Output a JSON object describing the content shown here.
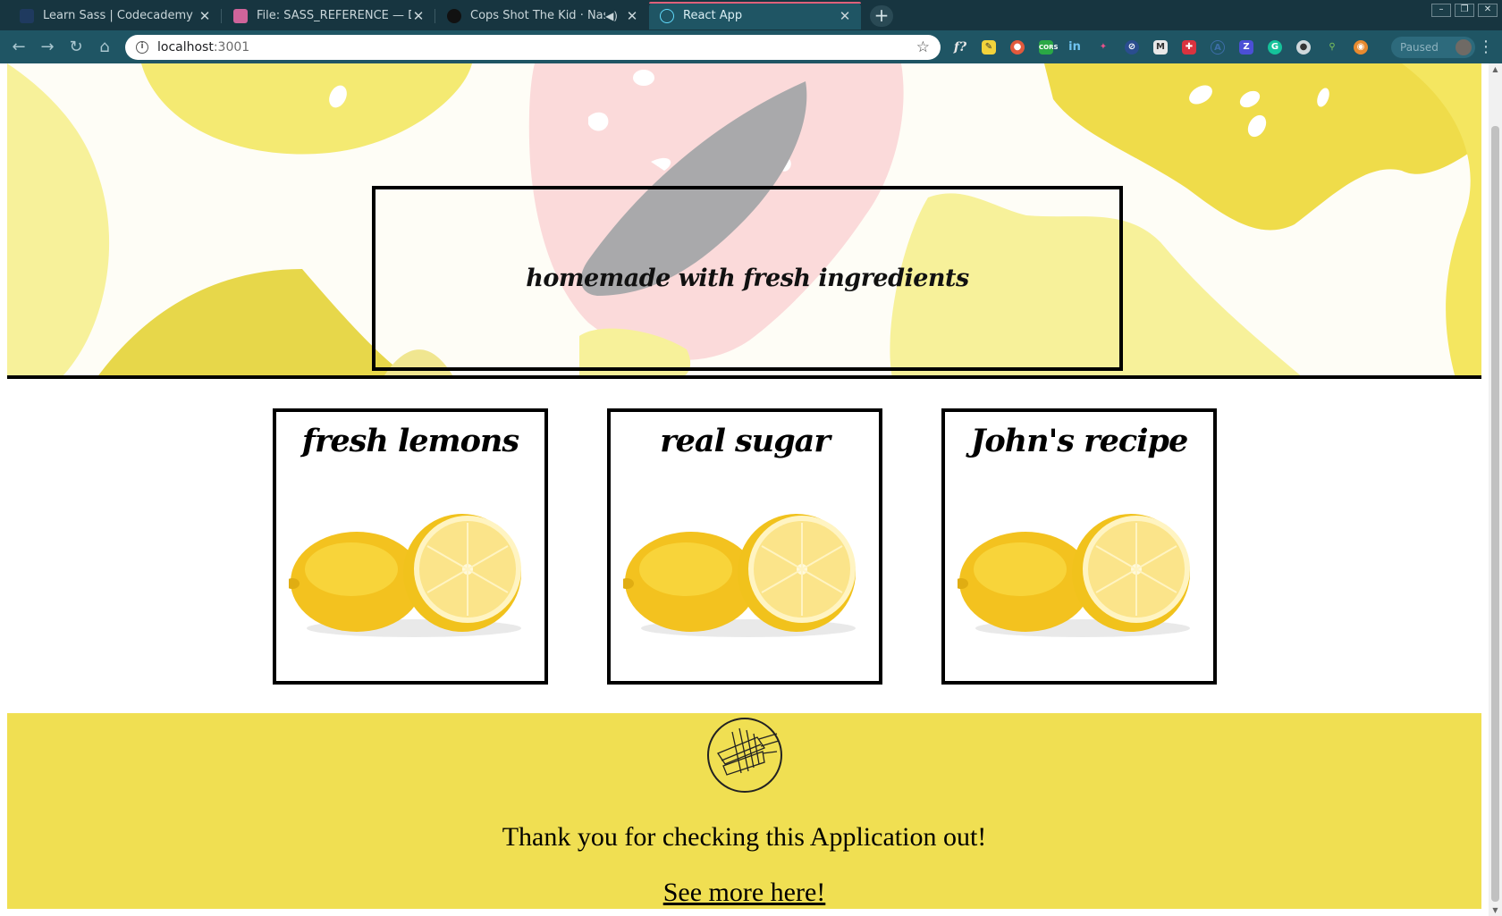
{
  "browser": {
    "tabs": [
      {
        "title": "Learn Sass | Codecademy",
        "favicon": "codecademy-icon",
        "color": "#1f3a5f"
      },
      {
        "title": "File: SASS_REFERENCE — Docu",
        "favicon": "sass-icon",
        "color": "#cf649a"
      },
      {
        "title": "Cops Shot The Kid · Nas, Ka",
        "favicon": "spotify-icon",
        "color": "#111111"
      },
      {
        "title": "React App",
        "favicon": "react-icon",
        "color": "#61dafb"
      }
    ],
    "address": {
      "host": "localhost",
      "port": ":3001"
    },
    "profile_status": "Paused"
  },
  "page": {
    "tagline": "homemade with fresh ingredients",
    "cards": [
      {
        "title": "fresh lemons"
      },
      {
        "title": "real sugar"
      },
      {
        "title": "John's recipe"
      }
    ],
    "footer": {
      "thanks": "Thank you for checking this Application out!",
      "link": "See more here!"
    }
  },
  "colors": {
    "chrome_dark": "#173540",
    "chrome_toolbar": "#1f5564",
    "footer_yellow": "#f0df52",
    "lemon_yellow": "#f4d23c",
    "hero_pink": "#fbdada"
  }
}
